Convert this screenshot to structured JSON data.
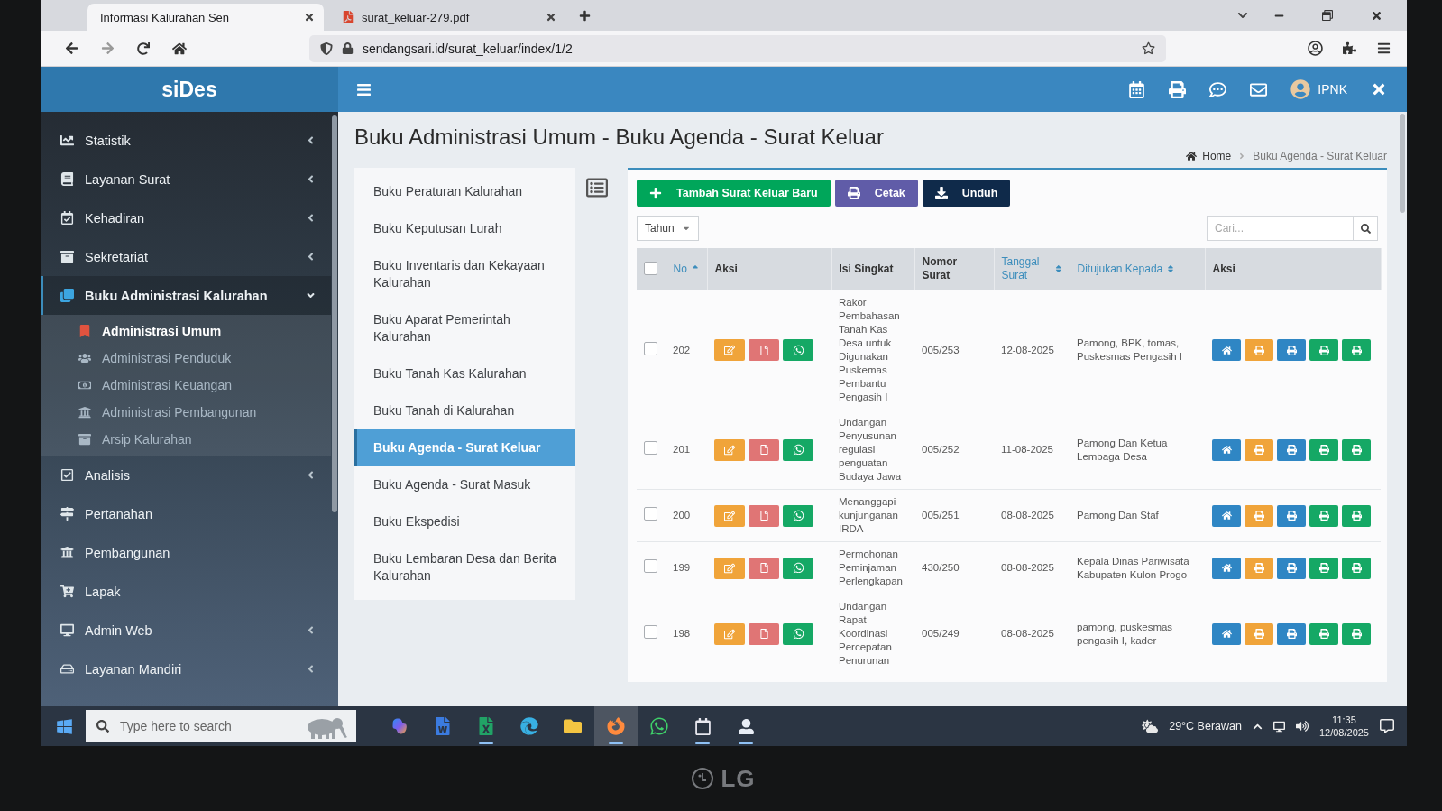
{
  "browser": {
    "tabs": [
      {
        "title": "Informasi Kalurahan Sen",
        "selected": true
      },
      {
        "title": "surat_keluar-279.pdf",
        "selected": false
      }
    ],
    "address": "sendangsari.id/surat_keluar/index/1/2"
  },
  "header": {
    "logo": "siDes",
    "user": "IPNK"
  },
  "sidebar": {
    "items": [
      {
        "label": "Statistik",
        "kind": "tree",
        "expanded": false,
        "selected": false
      },
      {
        "label": "Layanan Surat",
        "kind": "tree",
        "expanded": false,
        "selected": false
      },
      {
        "label": "Kehadiran",
        "kind": "tree",
        "expanded": false,
        "selected": false
      },
      {
        "label": "Sekretariat",
        "kind": "tree",
        "expanded": false,
        "selected": false
      },
      {
        "label": "Buku Administrasi Kalurahan",
        "kind": "tree",
        "expanded": true,
        "selected": true,
        "children": [
          {
            "label": "Administrasi Umum",
            "selected": true
          },
          {
            "label": "Administrasi Penduduk",
            "selected": false
          },
          {
            "label": "Administrasi Keuangan",
            "selected": false
          },
          {
            "label": "Administrasi Pembangunan",
            "selected": false
          },
          {
            "label": "Arsip Kalurahan",
            "selected": false
          }
        ]
      },
      {
        "label": "Analisis",
        "kind": "tree",
        "expanded": false,
        "selected": false
      },
      {
        "label": "Pertanahan",
        "kind": "link",
        "selected": false
      },
      {
        "label": "Pembangunan",
        "kind": "link",
        "selected": false
      },
      {
        "label": "Lapak",
        "kind": "link",
        "selected": false
      },
      {
        "label": "Admin Web",
        "kind": "tree",
        "expanded": false,
        "selected": false
      },
      {
        "label": "Layanan Mandiri",
        "kind": "tree",
        "expanded": false,
        "selected": false
      }
    ]
  },
  "page": {
    "title": "Buku Administrasi Umum - Buku Agenda - Surat Keluar",
    "breadcrumb": [
      "Home",
      "Buku Agenda - Surat Keluar"
    ]
  },
  "books": {
    "items": [
      {
        "label": "Buku Peraturan Kalurahan",
        "selected": false
      },
      {
        "label": "Buku Keputusan Lurah",
        "selected": false
      },
      {
        "label": "Buku Inventaris dan Kekayaan Kalurahan",
        "selected": false
      },
      {
        "label": "Buku Aparat Pemerintah Kalurahan",
        "selected": false
      },
      {
        "label": "Buku Tanah Kas Kalurahan",
        "selected": false
      },
      {
        "label": "Buku Tanah di Kalurahan",
        "selected": false
      },
      {
        "label": "Buku Agenda - Surat Keluar",
        "selected": true
      },
      {
        "label": "Buku Agenda - Surat Masuk",
        "selected": false
      },
      {
        "label": "Buku Ekspedisi",
        "selected": false
      },
      {
        "label": "Buku Lembaran Desa dan Berita Kalurahan",
        "selected": false
      }
    ]
  },
  "toolbar": {
    "buttons": [
      {
        "label": "Tambah Surat Keluar Baru",
        "kind": "add"
      },
      {
        "label": "Cetak",
        "kind": "print"
      },
      {
        "label": "Unduh",
        "kind": "download"
      }
    ]
  },
  "filter": {
    "value": "Tahun"
  },
  "search": {
    "placeholder": "Cari..."
  },
  "table": {
    "select_all": false,
    "columns": [
      {
        "label": "No",
        "sortable": true,
        "sorted": true
      },
      {
        "label": "Aksi",
        "sortable": false
      },
      {
        "label": "Isi Singkat",
        "sortable": false
      },
      {
        "label": "Nomor Surat",
        "sortable": false
      },
      {
        "label": "Tanggal Surat",
        "sortable": true,
        "sorted": false
      },
      {
        "label": "Ditujukan Kepada",
        "sortable": true,
        "sorted": false
      },
      {
        "label": "Aksi",
        "sortable": false
      }
    ],
    "rows": [
      {
        "checked": false,
        "no": "202",
        "summary": "Rakor Pembahasan Tanah Kas Desa untuk Digunakan Puskemas Pembantu Pengasih I",
        "number": "005/253",
        "date": "12-08-2025",
        "recipient": "Pamong, BPK, tomas, Puskesmas Pengasih I"
      },
      {
        "checked": false,
        "no": "201",
        "summary": "Undangan Penyusunan regulasi penguatan Budaya Jawa",
        "number": "005/252",
        "date": "11-08-2025",
        "recipient": "Pamong Dan Ketua Lembaga Desa"
      },
      {
        "checked": false,
        "no": "200",
        "summary": "Menanggapi kunjunganan IRDA",
        "number": "005/251",
        "date": "08-08-2025",
        "recipient": "Pamong Dan Staf"
      },
      {
        "checked": false,
        "no": "199",
        "summary": "Permohonan Peminjaman Perlengkapan",
        "number": "430/250",
        "date": "08-08-2025",
        "recipient": "Kepala Dinas Pariwisata Kabupaten Kulon Progo"
      },
      {
        "checked": false,
        "no": "198",
        "summary": "Undangan Rapat Koordinasi Percepatan Penurunan",
        "number": "005/249",
        "date": "08-08-2025",
        "recipient": "pamong, puskesmas pengasih I, kader"
      }
    ]
  },
  "taskbar": {
    "search_placeholder": "Type here to search",
    "apps": [
      {
        "open": false,
        "selected": false
      },
      {
        "open": false,
        "selected": false
      },
      {
        "open": true,
        "selected": false
      },
      {
        "open": false,
        "selected": false
      },
      {
        "open": false,
        "selected": false
      },
      {
        "open": true,
        "selected": true
      },
      {
        "open": false,
        "selected": false
      },
      {
        "open": true,
        "selected": false
      },
      {
        "open": true,
        "selected": false
      }
    ],
    "weather": "29°C Berawan",
    "time": "11:35",
    "date": "12/08/2025"
  },
  "monitor": {
    "brand": "LG"
  }
}
